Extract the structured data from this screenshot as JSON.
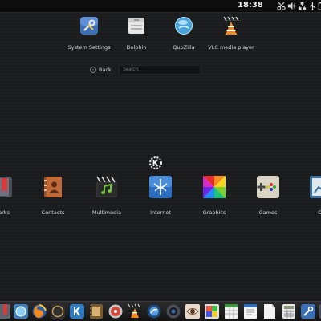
{
  "panel": {
    "clock": "18:38",
    "tray_icons": [
      "scissors-icon",
      "volume-icon",
      "network-icon",
      "usb-icon",
      "battery-icon"
    ]
  },
  "favorites": [
    {
      "label": "System Settings",
      "icon": "system-settings-icon"
    },
    {
      "label": "Dolphin",
      "icon": "dolphin-icon"
    },
    {
      "label": "QupZilla",
      "icon": "qupzilla-icon"
    },
    {
      "label": "VLC media player",
      "icon": "vlc-icon"
    }
  ],
  "nav": {
    "back_label": "Back",
    "search_placeholder": "Search..."
  },
  "categories": [
    {
      "label": "marks",
      "icon": "bookmarks-icon"
    },
    {
      "label": "Contacts",
      "icon": "contacts-icon"
    },
    {
      "label": "Multimedia",
      "icon": "multimedia-icon"
    },
    {
      "label": "Internet",
      "icon": "internet-icon"
    },
    {
      "label": "Graphics",
      "icon": "graphics-icon"
    },
    {
      "label": "Games",
      "icon": "games-icon"
    },
    {
      "label": "Of",
      "icon": "office-icon"
    }
  ],
  "dock": [
    "bookmarks-app-icon",
    "qupzilla-app-icon",
    "firefox-icon",
    "kde-app-icon",
    "video-player-icon",
    "disc-burner-icon",
    "vlc-app-icon",
    "web-browser-icon",
    "camera-icon",
    "eye-viewer-icon",
    "graphics-app-icon",
    "spreadsheet-icon",
    "document-icon",
    "text-file-icon",
    "calculator-icon",
    "system-settings-app-icon",
    "extra-icon"
  ]
}
